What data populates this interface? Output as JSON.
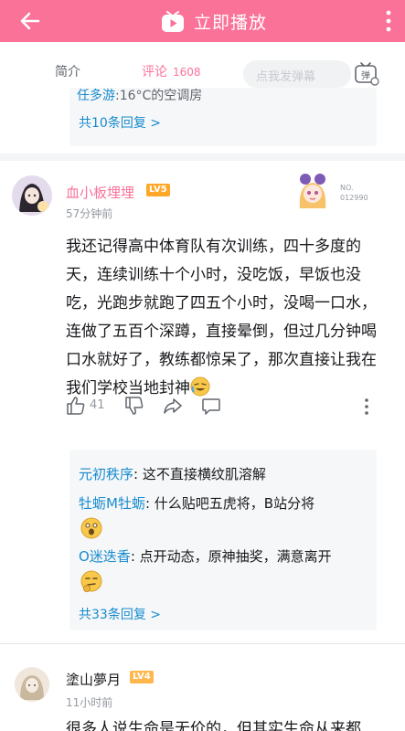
{
  "topbar": {
    "play_label": "立即播放"
  },
  "tabs": {
    "intro_label": "简介",
    "comment_label": "评论",
    "comment_count": "1608"
  },
  "danmaku": {
    "placeholder": "点我发弹幕",
    "button_label": "弹"
  },
  "prev_reply_box": {
    "cut_user": "任多游",
    "cut_text": ":16°C的空调房",
    "more_replies": "共10条回复 >"
  },
  "comment1": {
    "username": "血小板埋埋",
    "level": "LV5",
    "time": "57分钟前",
    "badge_no": "NO.",
    "badge_number": "012990",
    "text": "我还记得高中体育队有次训练，四十多度的天，连续训练十个小时，没吃饭，早饭也没吃，光跑步就跑了四五个小时，没喝一口水，连做了五百个深蹲，直接晕倒，但过几分钟喝口水就好了，教练都惊呆了，那次直接让我在我们学校当地封神",
    "likes": "41",
    "replies": [
      {
        "user": "元初秩序",
        "text": ": 这不直接横纹肌溶解"
      },
      {
        "user": "牡蛎M牡蛎",
        "text": ": 什么贴吧五虎将，B站分将"
      },
      {
        "user": "O迷迭香",
        "text": ": 点开动态，原神抽奖，满意离开"
      }
    ],
    "more_replies": "共33条回复 >"
  },
  "comment2": {
    "username": "塗山夢月",
    "level": "LV4",
    "time": "11小时前",
    "text": "很多人说生命是无价的，但其实生命从来都"
  },
  "colors": {
    "brand_pink": "#fb7299",
    "link_blue": "#178bcf",
    "muted": "#9499a0"
  }
}
